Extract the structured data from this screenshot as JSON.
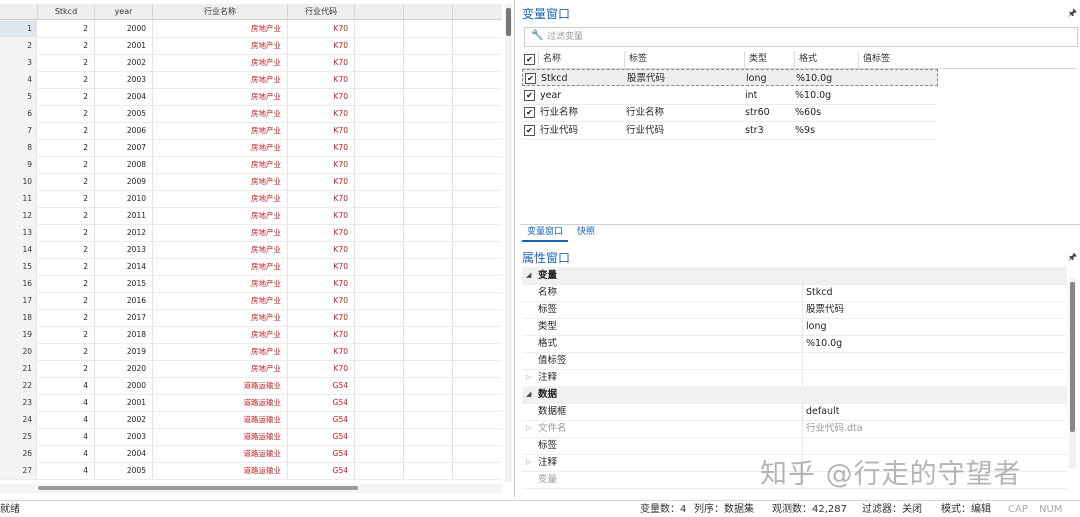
{
  "editor": {
    "columns": [
      "Stkcd",
      "year",
      "行业名称",
      "行业代码"
    ],
    "rows": [
      {
        "n": "1",
        "stkcd": "2",
        "year": "2000",
        "ind": "房地产业",
        "code": "K70"
      },
      {
        "n": "2",
        "stkcd": "2",
        "year": "2001",
        "ind": "房地产业",
        "code": "K70"
      },
      {
        "n": "3",
        "stkcd": "2",
        "year": "2002",
        "ind": "房地产业",
        "code": "K70"
      },
      {
        "n": "4",
        "stkcd": "2",
        "year": "2003",
        "ind": "房地产业",
        "code": "K70"
      },
      {
        "n": "5",
        "stkcd": "2",
        "year": "2004",
        "ind": "房地产业",
        "code": "K70"
      },
      {
        "n": "6",
        "stkcd": "2",
        "year": "2005",
        "ind": "房地产业",
        "code": "K70"
      },
      {
        "n": "7",
        "stkcd": "2",
        "year": "2006",
        "ind": "房地产业",
        "code": "K70"
      },
      {
        "n": "8",
        "stkcd": "2",
        "year": "2007",
        "ind": "房地产业",
        "code": "K70"
      },
      {
        "n": "9",
        "stkcd": "2",
        "year": "2008",
        "ind": "房地产业",
        "code": "K70"
      },
      {
        "n": "10",
        "stkcd": "2",
        "year": "2009",
        "ind": "房地产业",
        "code": "K70"
      },
      {
        "n": "11",
        "stkcd": "2",
        "year": "2010",
        "ind": "房地产业",
        "code": "K70"
      },
      {
        "n": "12",
        "stkcd": "2",
        "year": "2011",
        "ind": "房地产业",
        "code": "K70"
      },
      {
        "n": "13",
        "stkcd": "2",
        "year": "2012",
        "ind": "房地产业",
        "code": "K70"
      },
      {
        "n": "14",
        "stkcd": "2",
        "year": "2013",
        "ind": "房地产业",
        "code": "K70"
      },
      {
        "n": "15",
        "stkcd": "2",
        "year": "2014",
        "ind": "房地产业",
        "code": "K70"
      },
      {
        "n": "16",
        "stkcd": "2",
        "year": "2015",
        "ind": "房地产业",
        "code": "K70"
      },
      {
        "n": "17",
        "stkcd": "2",
        "year": "2016",
        "ind": "房地产业",
        "code": "K70"
      },
      {
        "n": "18",
        "stkcd": "2",
        "year": "2017",
        "ind": "房地产业",
        "code": "K70"
      },
      {
        "n": "19",
        "stkcd": "2",
        "year": "2018",
        "ind": "房地产业",
        "code": "K70"
      },
      {
        "n": "20",
        "stkcd": "2",
        "year": "2019",
        "ind": "房地产业",
        "code": "K70"
      },
      {
        "n": "21",
        "stkcd": "2",
        "year": "2020",
        "ind": "房地产业",
        "code": "K70"
      },
      {
        "n": "22",
        "stkcd": "4",
        "year": "2000",
        "ind": "道路运输业",
        "code": "G54"
      },
      {
        "n": "23",
        "stkcd": "4",
        "year": "2001",
        "ind": "道路运输业",
        "code": "G54"
      },
      {
        "n": "24",
        "stkcd": "4",
        "year": "2002",
        "ind": "道路运输业",
        "code": "G54"
      },
      {
        "n": "25",
        "stkcd": "4",
        "year": "2003",
        "ind": "道路运输业",
        "code": "G54"
      },
      {
        "n": "26",
        "stkcd": "4",
        "year": "2004",
        "ind": "道路运输业",
        "code": "G54"
      },
      {
        "n": "27",
        "stkcd": "4",
        "year": "2005",
        "ind": "道路运输业",
        "code": "G54"
      }
    ]
  },
  "variables": {
    "title": "变量窗口",
    "filter_placeholder": "过滤变量",
    "headers": [
      "名称",
      "标签",
      "类型",
      "格式",
      "值标签"
    ],
    "rows": [
      {
        "name": "Stkcd",
        "label": "股票代码",
        "type": "long",
        "format": "%10.0g"
      },
      {
        "name": "year",
        "label": "",
        "type": "int",
        "format": "%10.0g"
      },
      {
        "name": "行业名称",
        "label": "行业名称",
        "type": "str60",
        "format": "%60s"
      },
      {
        "name": "行业代码",
        "label": "行业代码",
        "type": "str3",
        "format": "%9s"
      }
    ],
    "tabs": [
      "变量窗口",
      "快照"
    ]
  },
  "properties": {
    "title": "属性窗口",
    "rows": [
      {
        "kind": "section",
        "key": "变量"
      },
      {
        "kind": "item",
        "key": "名称",
        "value": "Stkcd"
      },
      {
        "kind": "item",
        "key": "标签",
        "value": "股票代码"
      },
      {
        "kind": "item",
        "key": "类型",
        "value": "long"
      },
      {
        "kind": "item",
        "key": "格式",
        "value": "%10.0g"
      },
      {
        "kind": "item",
        "key": "值标签",
        "value": ""
      },
      {
        "kind": "collapsed",
        "key": "注释",
        "value": ""
      },
      {
        "kind": "section",
        "key": "数据"
      },
      {
        "kind": "item",
        "key": "数据框",
        "value": "default"
      },
      {
        "kind": "collapsed-gray",
        "key": "文件名",
        "value": "行业代码.dta"
      },
      {
        "kind": "item",
        "key": "标签",
        "value": ""
      },
      {
        "kind": "collapsed",
        "key": "注释",
        "value": ""
      },
      {
        "kind": "gray",
        "key": "变量",
        "value": ""
      }
    ]
  },
  "watermark": "知乎 @行走的守望者",
  "status": {
    "ready": "就绪",
    "vars": "变量数：4",
    "order": "列序：数据集",
    "obs": "观测数：42,287",
    "filter": "过滤器：关闭",
    "mode": "模式：编辑",
    "cap": "CAP",
    "num": "NUM"
  },
  "colors": {
    "accent": "#1b64b0",
    "string_value": "#b52020"
  },
  "icons": {
    "filter": "wrench-icon",
    "pin": "pin-icon"
  }
}
